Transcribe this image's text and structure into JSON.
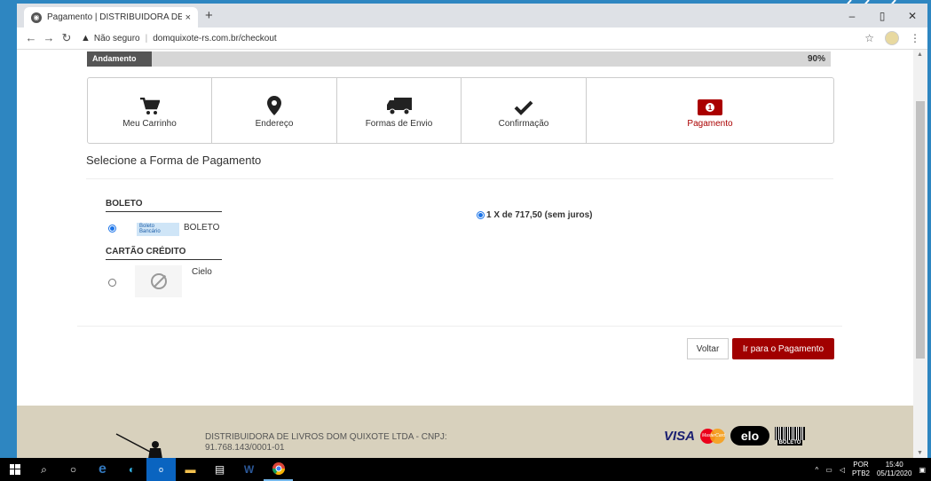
{
  "browser": {
    "tab_title": "Pagamento | DISTRIBUIDORA DE",
    "tab_close": "×",
    "new_tab": "+",
    "security_label": "Não seguro",
    "url": "domquixote-rs.com.br/checkout",
    "minimize": "–",
    "maximize": "▯",
    "close": "✕"
  },
  "progress": {
    "label": "Andamento",
    "percent_text": "90%",
    "value": 0.9
  },
  "steps": [
    {
      "label": "Meu Carrinho",
      "icon": "cart-icon"
    },
    {
      "label": "Endereço",
      "icon": "map-pin-icon"
    },
    {
      "label": "Formas de Envio",
      "icon": "truck-icon"
    },
    {
      "label": "Confirmação",
      "icon": "check-icon"
    },
    {
      "label": "Pagamento",
      "icon": "money-icon",
      "active": true
    }
  ],
  "section_title": "Selecione a Forma de Pagamento",
  "payment": {
    "boleto_group": "BOLETO",
    "boleto_logo_line1": "Boleto",
    "boleto_logo_line2": "Bancário",
    "boleto_option": "BOLETO",
    "card_group": "CARTÃO CRÉDITO",
    "card_option": "Cielo",
    "installment": "1 X de 717,50 (sem juros)"
  },
  "buttons": {
    "back": "Voltar",
    "pay": "Ir para o Pagamento"
  },
  "footer": {
    "company_line1": "DISTRIBUIDORA DE LIVROS DOM QUIXOTE LTDA - CNPJ:",
    "company_line2": "91.768.143/0001-01",
    "visa": "VISA",
    "mastercard": "MasterCard",
    "elo": "elo",
    "boleto": "BOLETO"
  },
  "taskbar": {
    "lang1": "POR",
    "lang2": "PTB2",
    "time": "15:40",
    "date": "05/11/2020"
  },
  "colors": {
    "accent": "#a10000",
    "footer_bg": "#d8d1bd",
    "progress_fill": "#555555"
  }
}
